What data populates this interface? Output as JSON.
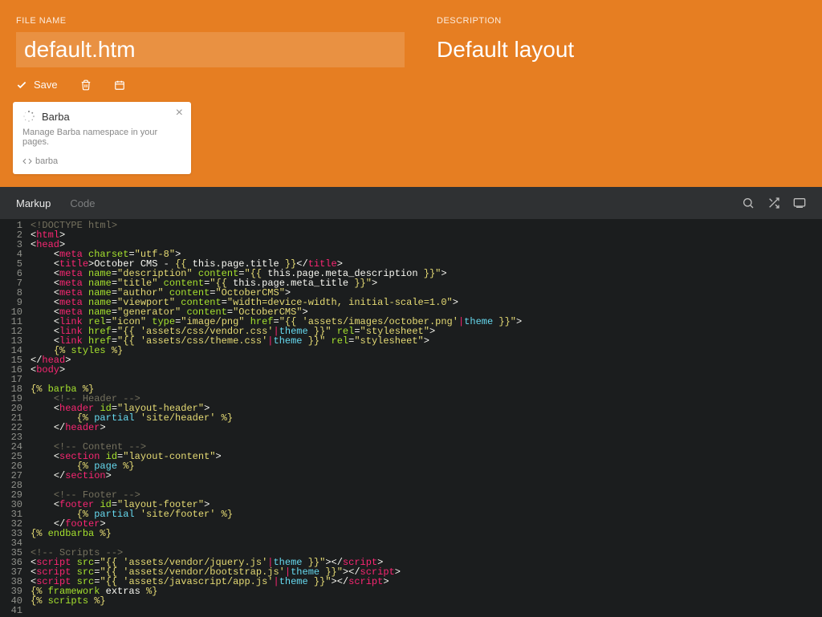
{
  "header": {
    "filename_label": "FILE NAME",
    "filename_value": "default.htm",
    "description_label": "DESCRIPTION",
    "description_value": "Default layout",
    "save_label": "Save"
  },
  "card": {
    "title": "Barba",
    "description": "Manage Barba namespace in your pages.",
    "tag": "barba"
  },
  "tabs": {
    "markup": "Markup",
    "code": "Code"
  },
  "code_lines": [
    {
      "n": 1,
      "html": "<span class='cm'>&lt;!DOCTYPE html&gt;</span>"
    },
    {
      "n": 2,
      "html": "<span class='pu'>&lt;</span><span class='tg'>html</span><span class='pu'>&gt;</span>"
    },
    {
      "n": 3,
      "html": "<span class='pu'>&lt;</span><span class='tg'>head</span><span class='pu'>&gt;</span>"
    },
    {
      "n": 4,
      "html": "    <span class='pu'>&lt;</span><span class='tg'>meta</span> <span class='at'>charset</span><span class='pu'>=</span><span class='st'>\"utf-8\"</span><span class='pu'>&gt;</span>"
    },
    {
      "n": 5,
      "html": "    <span class='pu'>&lt;</span><span class='tg'>title</span><span class='pu'>&gt;</span>October CMS - <span class='tw'>{{</span> this.page.title <span class='tw'>}}</span><span class='pu'>&lt;/</span><span class='tg'>title</span><span class='pu'>&gt;</span>"
    },
    {
      "n": 6,
      "html": "    <span class='pu'>&lt;</span><span class='tg'>meta</span> <span class='at'>name</span><span class='pu'>=</span><span class='st'>\"description\"</span> <span class='at'>content</span><span class='pu'>=</span><span class='st'>\"</span><span class='tw'>{{</span> this.page.meta_description <span class='tw'>}}</span><span class='st'>\"</span><span class='pu'>&gt;</span>"
    },
    {
      "n": 7,
      "html": "    <span class='pu'>&lt;</span><span class='tg'>meta</span> <span class='at'>name</span><span class='pu'>=</span><span class='st'>\"title\"</span> <span class='at'>content</span><span class='pu'>=</span><span class='st'>\"</span><span class='tw'>{{</span> this.page.meta_title <span class='tw'>}}</span><span class='st'>\"</span><span class='pu'>&gt;</span>"
    },
    {
      "n": 8,
      "html": "    <span class='pu'>&lt;</span><span class='tg'>meta</span> <span class='at'>name</span><span class='pu'>=</span><span class='st'>\"author\"</span> <span class='at'>content</span><span class='pu'>=</span><span class='st'>\"OctoberCMS\"</span><span class='pu'>&gt;</span>"
    },
    {
      "n": 9,
      "html": "    <span class='pu'>&lt;</span><span class='tg'>meta</span> <span class='at'>name</span><span class='pu'>=</span><span class='st'>\"viewport\"</span> <span class='at'>content</span><span class='pu'>=</span><span class='st'>\"width=device-width, initial-scale=1.0\"</span><span class='pu'>&gt;</span>"
    },
    {
      "n": 10,
      "html": "    <span class='pu'>&lt;</span><span class='tg'>meta</span> <span class='at'>name</span><span class='pu'>=</span><span class='st'>\"generator\"</span> <span class='at'>content</span><span class='pu'>=</span><span class='st'>\"OctoberCMS\"</span><span class='pu'>&gt;</span>"
    },
    {
      "n": 11,
      "html": "    <span class='pu'>&lt;</span><span class='tg'>link</span> <span class='at'>rel</span><span class='pu'>=</span><span class='st'>\"icon\"</span> <span class='at'>type</span><span class='pu'>=</span><span class='st'>\"image/png\"</span> <span class='at'>href</span><span class='pu'>=</span><span class='st'>\"</span><span class='tw'>{{</span> <span class='st'>'assets/images/october.png'</span><span class='op'>|</span><span class='kw'>theme</span> <span class='tw'>}}</span><span class='st'>\"</span><span class='pu'>&gt;</span>"
    },
    {
      "n": 12,
      "html": "    <span class='pu'>&lt;</span><span class='tg'>link</span> <span class='at'>href</span><span class='pu'>=</span><span class='st'>\"</span><span class='tw'>{{</span> <span class='st'>'assets/css/vendor.css'</span><span class='op'>|</span><span class='kw'>theme</span> <span class='tw'>}}</span><span class='st'>\"</span> <span class='at'>rel</span><span class='pu'>=</span><span class='st'>\"stylesheet\"</span><span class='pu'>&gt;</span>"
    },
    {
      "n": 13,
      "html": "    <span class='pu'>&lt;</span><span class='tg'>link</span> <span class='at'>href</span><span class='pu'>=</span><span class='st'>\"</span><span class='tw'>{{</span> <span class='st'>'assets/css/theme.css'</span><span class='op'>|</span><span class='kw'>theme</span> <span class='tw'>}}</span><span class='st'>\"</span> <span class='at'>rel</span><span class='pu'>=</span><span class='st'>\"stylesheet\"</span><span class='pu'>&gt;</span>"
    },
    {
      "n": 14,
      "html": "    <span class='tw'>{%</span> <span class='fn'>styles</span> <span class='tw'>%}</span>"
    },
    {
      "n": 15,
      "html": "<span class='pu'>&lt;/</span><span class='tg'>head</span><span class='pu'>&gt;</span>"
    },
    {
      "n": 16,
      "html": "<span class='pu'>&lt;</span><span class='tg'>body</span><span class='pu'>&gt;</span>"
    },
    {
      "n": 17,
      "html": ""
    },
    {
      "n": 18,
      "html": "<span class='tw'>{%</span> <span class='fn'>barba</span> <span class='tw'>%}</span>"
    },
    {
      "n": 19,
      "html": "    <span class='cm'>&lt;!-- Header --&gt;</span>"
    },
    {
      "n": 20,
      "html": "    <span class='pu'>&lt;</span><span class='tg'>header</span> <span class='at'>id</span><span class='pu'>=</span><span class='st'>\"layout-header\"</span><span class='pu'>&gt;</span>"
    },
    {
      "n": 21,
      "html": "        <span class='tw'>{%</span> <span class='kw'>partial</span> <span class='st'>'site/header'</span> <span class='tw'>%}</span>"
    },
    {
      "n": 22,
      "html": "    <span class='pu'>&lt;/</span><span class='tg'>header</span><span class='pu'>&gt;</span>"
    },
    {
      "n": 23,
      "html": ""
    },
    {
      "n": 24,
      "html": "    <span class='cm'>&lt;!-- Content --&gt;</span>"
    },
    {
      "n": 25,
      "html": "    <span class='pu'>&lt;</span><span class='tg'>section</span> <span class='at'>id</span><span class='pu'>=</span><span class='st'>\"layout-content\"</span><span class='pu'>&gt;</span>"
    },
    {
      "n": 26,
      "html": "        <span class='tw'>{%</span> <span class='kw'>page</span> <span class='tw'>%}</span>"
    },
    {
      "n": 27,
      "html": "    <span class='pu'>&lt;/</span><span class='tg'>section</span><span class='pu'>&gt;</span>"
    },
    {
      "n": 28,
      "html": ""
    },
    {
      "n": 29,
      "html": "    <span class='cm'>&lt;!-- Footer --&gt;</span>"
    },
    {
      "n": 30,
      "html": "    <span class='pu'>&lt;</span><span class='tg'>footer</span> <span class='at'>id</span><span class='pu'>=</span><span class='st'>\"layout-footer\"</span><span class='pu'>&gt;</span>"
    },
    {
      "n": 31,
      "html": "        <span class='tw'>{%</span> <span class='kw'>partial</span> <span class='st'>'site/footer'</span> <span class='tw'>%}</span>"
    },
    {
      "n": 32,
      "html": "    <span class='pu'>&lt;/</span><span class='tg'>footer</span><span class='pu'>&gt;</span>"
    },
    {
      "n": 33,
      "html": "<span class='tw'>{%</span> <span class='fn'>endbarba</span> <span class='tw'>%}</span>"
    },
    {
      "n": 34,
      "html": ""
    },
    {
      "n": 35,
      "html": "<span class='cm'>&lt;!-- Scripts --&gt;</span>"
    },
    {
      "n": 36,
      "html": "<span class='pu'>&lt;</span><span class='tg'>script</span> <span class='at'>src</span><span class='pu'>=</span><span class='st'>\"</span><span class='tw'>{{</span> <span class='st'>'assets/vendor/jquery.js'</span><span class='op'>|</span><span class='kw'>theme</span> <span class='tw'>}}</span><span class='st'>\"</span><span class='pu'>&gt;&lt;/</span><span class='tg'>script</span><span class='pu'>&gt;</span>"
    },
    {
      "n": 37,
      "html": "<span class='pu'>&lt;</span><span class='tg'>script</span> <span class='at'>src</span><span class='pu'>=</span><span class='st'>\"</span><span class='tw'>{{</span> <span class='st'>'assets/vendor/bootstrap.js'</span><span class='op'>|</span><span class='kw'>theme</span> <span class='tw'>}}</span><span class='st'>\"</span><span class='pu'>&gt;&lt;/</span><span class='tg'>script</span><span class='pu'>&gt;</span>"
    },
    {
      "n": 38,
      "html": "<span class='pu'>&lt;</span><span class='tg'>script</span> <span class='at'>src</span><span class='pu'>=</span><span class='st'>\"</span><span class='tw'>{{</span> <span class='st'>'assets/javascript/app.js'</span><span class='op'>|</span><span class='kw'>theme</span> <span class='tw'>}}</span><span class='st'>\"</span><span class='pu'>&gt;&lt;/</span><span class='tg'>script</span><span class='pu'>&gt;</span>"
    },
    {
      "n": 39,
      "html": "<span class='tw'>{%</span> <span class='fn'>framework</span> extras <span class='tw'>%}</span>"
    },
    {
      "n": 40,
      "html": "<span class='tw'>{%</span> <span class='fn'>scripts</span> <span class='tw'>%}</span>"
    },
    {
      "n": 41,
      "html": ""
    }
  ]
}
